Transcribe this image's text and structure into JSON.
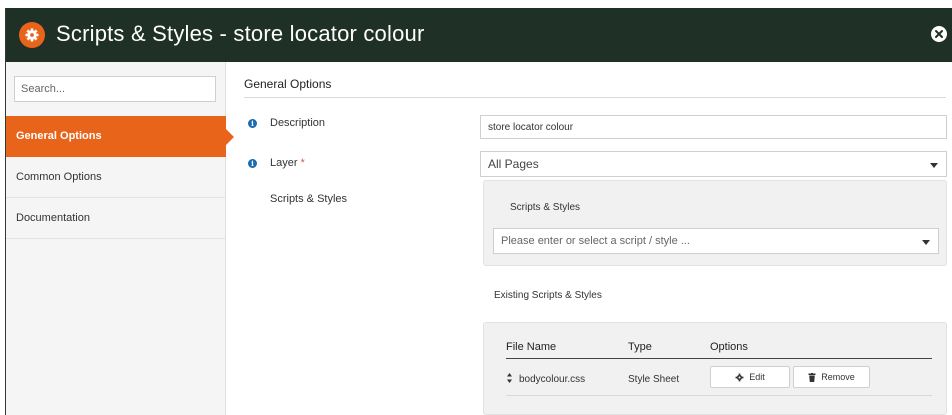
{
  "window": {
    "title": "Scripts & Styles - store locator colour",
    "icons": {
      "title": "gear-icon",
      "close": "close-icon"
    },
    "colors": {
      "titlebar": "#1f3026",
      "accent": "#e9641b",
      "info": "#1c6cb0"
    }
  },
  "sidebar": {
    "search_placeholder": "Search...",
    "items": [
      {
        "label": "General Options",
        "active": true
      },
      {
        "label": "Common Options",
        "active": false
      },
      {
        "label": "Documentation",
        "active": false
      }
    ]
  },
  "main": {
    "section_title": "General Options",
    "description": {
      "label": "Description",
      "value": "store locator colour"
    },
    "layer": {
      "label": "Layer",
      "required_mark": "*",
      "value": "All Pages"
    },
    "scripts_styles": {
      "label": "Scripts & Styles",
      "panel_label": "Scripts & Styles",
      "placeholder": "Please enter or select a script / style ..."
    },
    "existing": {
      "label": "Existing Scripts & Styles",
      "columns": [
        "File Name",
        "Type",
        "Options"
      ],
      "rows": [
        {
          "file_name": "bodycolour.css",
          "type": "Style Sheet",
          "edit_label": "Edit",
          "remove_label": "Remove"
        }
      ]
    }
  }
}
